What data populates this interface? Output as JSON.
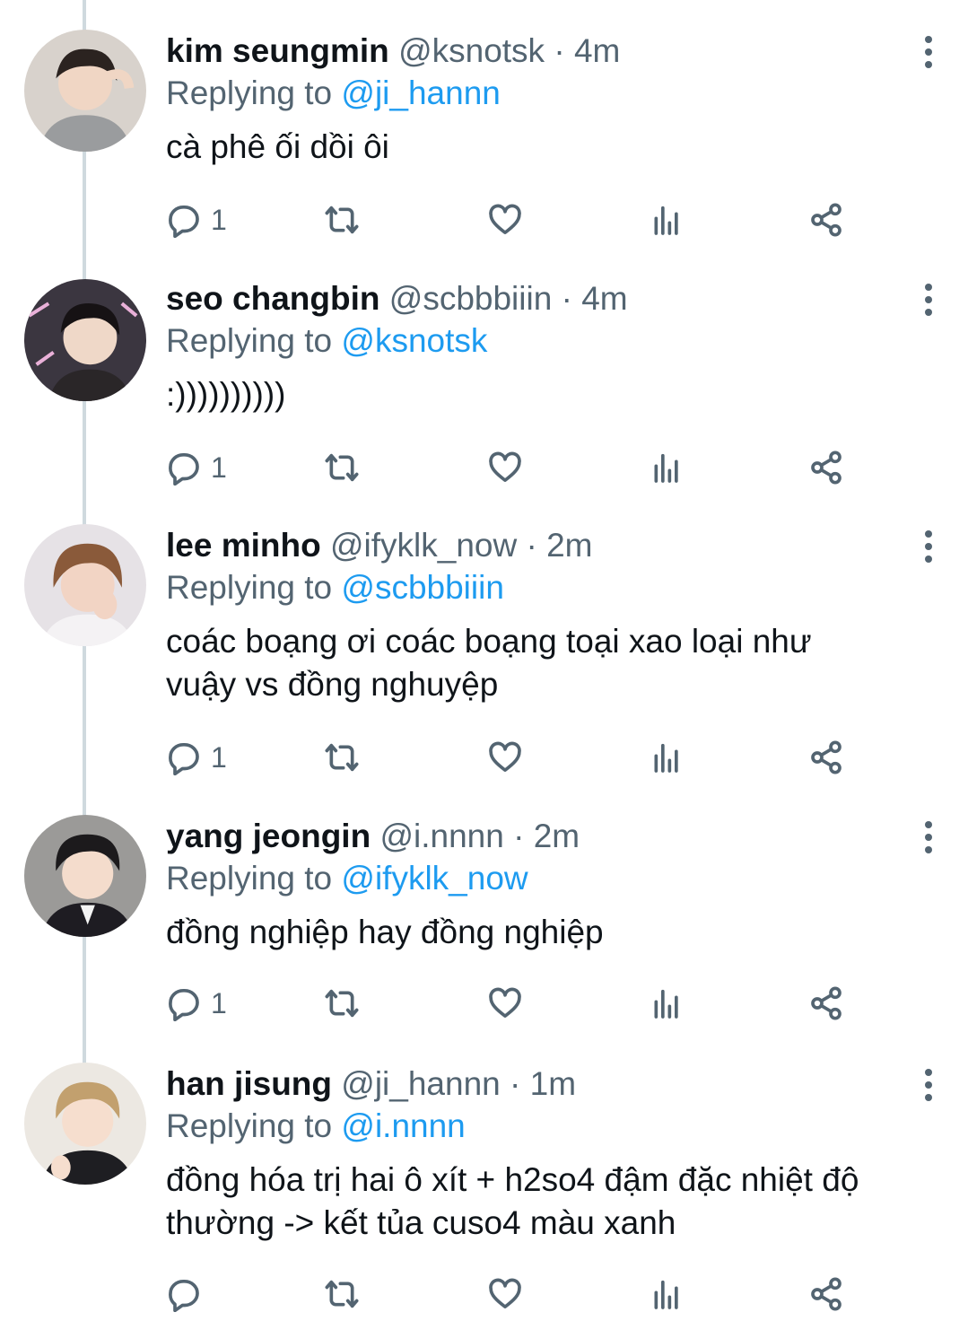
{
  "tweets": [
    {
      "name": "kim seungmin",
      "handle": "@ksnotsk",
      "separator": "·",
      "time": "4m",
      "replying_prefix": "Replying to",
      "replying_to": "@ji_hannn",
      "lines": [
        "cà phê ối dồi ôi"
      ],
      "reply_count": "1"
    },
    {
      "name": "seo changbin",
      "handle": "@scbbbiiin",
      "separator": "·",
      "time": "4m",
      "replying_prefix": "Replying to",
      "replying_to": "@ksnotsk",
      "lines": [
        ":))))))))))"
      ],
      "reply_count": "1"
    },
    {
      "name": "lee minho",
      "handle": "@ifyklk_now",
      "separator": "·",
      "time": "2m",
      "replying_prefix": "Replying to",
      "replying_to": "@scbbbiiin",
      "lines": [
        "coác boạng ơi coác boạng toại xao loại như",
        "vuậy vs đồng nghuyệp"
      ],
      "reply_count": "1"
    },
    {
      "name": "yang jeongin",
      "handle": "@i.nnnn",
      "separator": "·",
      "time": "2m",
      "replying_prefix": "Replying to",
      "replying_to": "@ifyklk_now",
      "lines": [
        "đồng nghiệp hay đồng nghiệp"
      ],
      "reply_count": "1"
    },
    {
      "name": "han jisung",
      "handle": "@ji_hannn",
      "separator": "·",
      "time": "1m",
      "replying_prefix": "Replying to",
      "replying_to": "@i.nnnn",
      "lines": [
        "đồng hóa trị hai ô xít + h2so4 đậm đặc nhiệt độ",
        "thường -> kết tủa cuso4 màu xanh"
      ],
      "reply_count": ""
    }
  ],
  "colors": {
    "link": "#1d9bf0",
    "secondary_text": "#536471",
    "primary_text": "#0f1419",
    "thread_line": "#cfd9de"
  },
  "icons": [
    "reply-icon",
    "retweet-icon",
    "like-icon",
    "analytics-icon",
    "share-icon",
    "more-options-icon"
  ]
}
